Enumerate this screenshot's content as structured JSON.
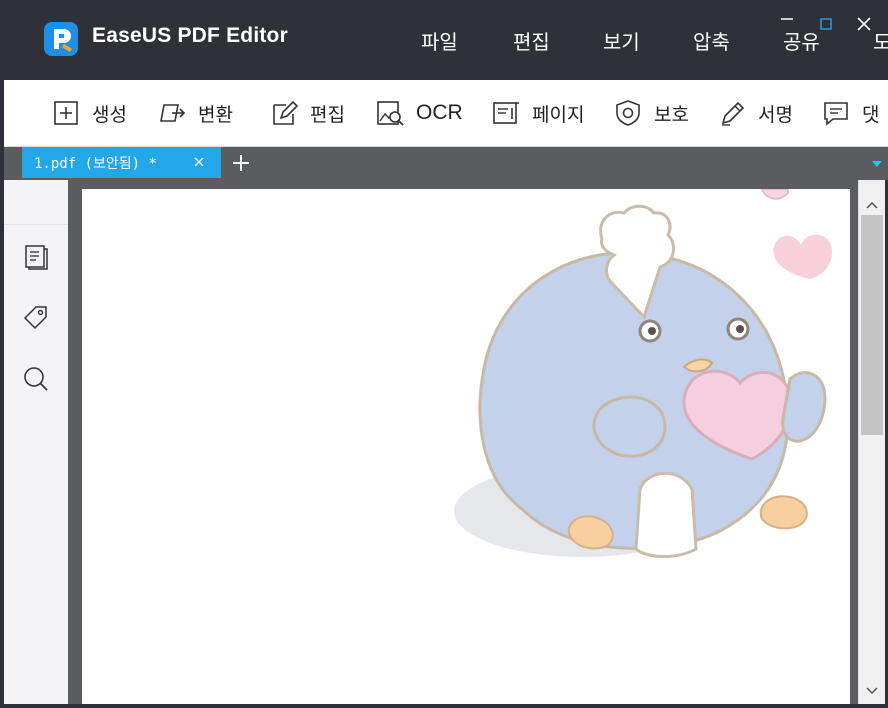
{
  "app": {
    "title": "EaseUS PDF Editor",
    "brand_color": "#22a7e8"
  },
  "menu": [
    "파일",
    "편집",
    "보기",
    "압축",
    "공유",
    "도"
  ],
  "toolbar": [
    {
      "label": "생성",
      "icon": "plus-box-icon"
    },
    {
      "label": "변환",
      "icon": "convert-doc-icon"
    },
    {
      "label": "편집",
      "icon": "edit-pen-icon"
    },
    {
      "label": "OCR",
      "icon": "ocr-scan-icon"
    },
    {
      "label": "페이지",
      "icon": "page-icon"
    },
    {
      "label": "보호",
      "icon": "shield-icon"
    },
    {
      "label": "서명",
      "icon": "signature-pen-icon"
    },
    {
      "label": "댓",
      "icon": "comment-icon"
    }
  ],
  "tabs": [
    {
      "label": "1.pdf (보안됨) *",
      "active": true
    }
  ],
  "sidebar": [
    "pages-icon",
    "bookmark-tag-icon",
    "search-icon"
  ]
}
